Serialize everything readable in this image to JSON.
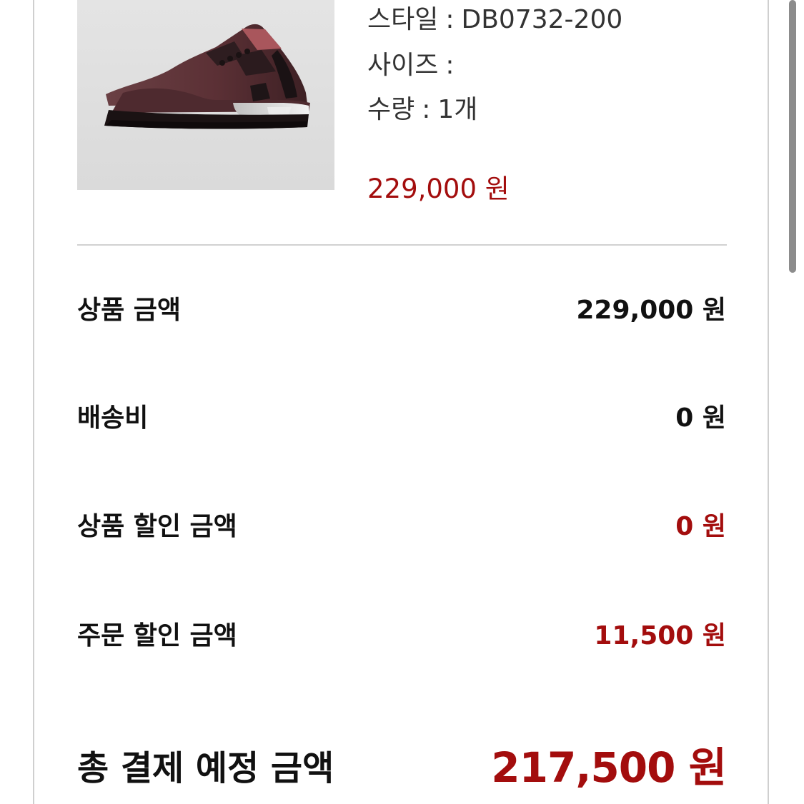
{
  "product": {
    "image_alt": "brown sneaker product image",
    "style_label": "스타일",
    "style_value": "DB0732-200",
    "size_label": "사이즈",
    "size_value": "",
    "qty_label": "수량",
    "qty_value": "1개",
    "separator": ":",
    "price": "229,000 원"
  },
  "summary": {
    "rows": [
      {
        "label": "상품 금액",
        "value": "229,000 원"
      },
      {
        "label": "배송비",
        "value": "0 원"
      },
      {
        "label": "상품 할인 금액",
        "value": "0 원"
      },
      {
        "label": "주문 할인 금액",
        "value": "11,500 원"
      }
    ],
    "total_label": "총 결제 예정 금액",
    "total_value": "217,500 원"
  },
  "colors": {
    "accent": "#a30d0d",
    "divider": "#d1d1d1",
    "panel_border": "#cfcfcf"
  },
  "icons": {
    "product_image": "sneaker-image"
  }
}
